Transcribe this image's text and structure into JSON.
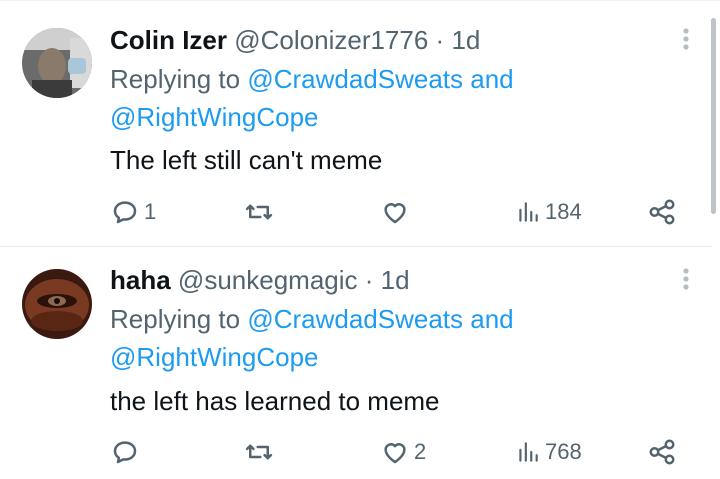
{
  "tweets": [
    {
      "display_name": "Colin Izer",
      "handle": "@Colonizer1776",
      "separator": "·",
      "time": "1d",
      "replying_prefix": "Replying to",
      "replying_to_1": "@CrawdadSweats",
      "replying_and": "and",
      "replying_to_2": "@RightWingCope",
      "text": "The left still can't meme",
      "reply_count": "1",
      "retweet_count": "",
      "like_count": "",
      "view_count": "184"
    },
    {
      "display_name": "haha",
      "handle": "@sunkegmagic",
      "separator": "·",
      "time": "1d",
      "replying_prefix": "Replying to",
      "replying_to_1": "@CrawdadSweats",
      "replying_and": "and",
      "replying_to_2": "@RightWingCope",
      "text": "the left has learned to meme",
      "reply_count": "",
      "retweet_count": "",
      "like_count": "2",
      "view_count": "768"
    }
  ],
  "colors": {
    "link": "#1d9bf0",
    "secondary_text": "#536471",
    "primary_text": "#0f1419",
    "divider": "#e7e9ea"
  },
  "icons": [
    "more-vertical-icon",
    "reply-icon",
    "retweet-icon",
    "like-icon",
    "views-icon",
    "share-icon"
  ]
}
